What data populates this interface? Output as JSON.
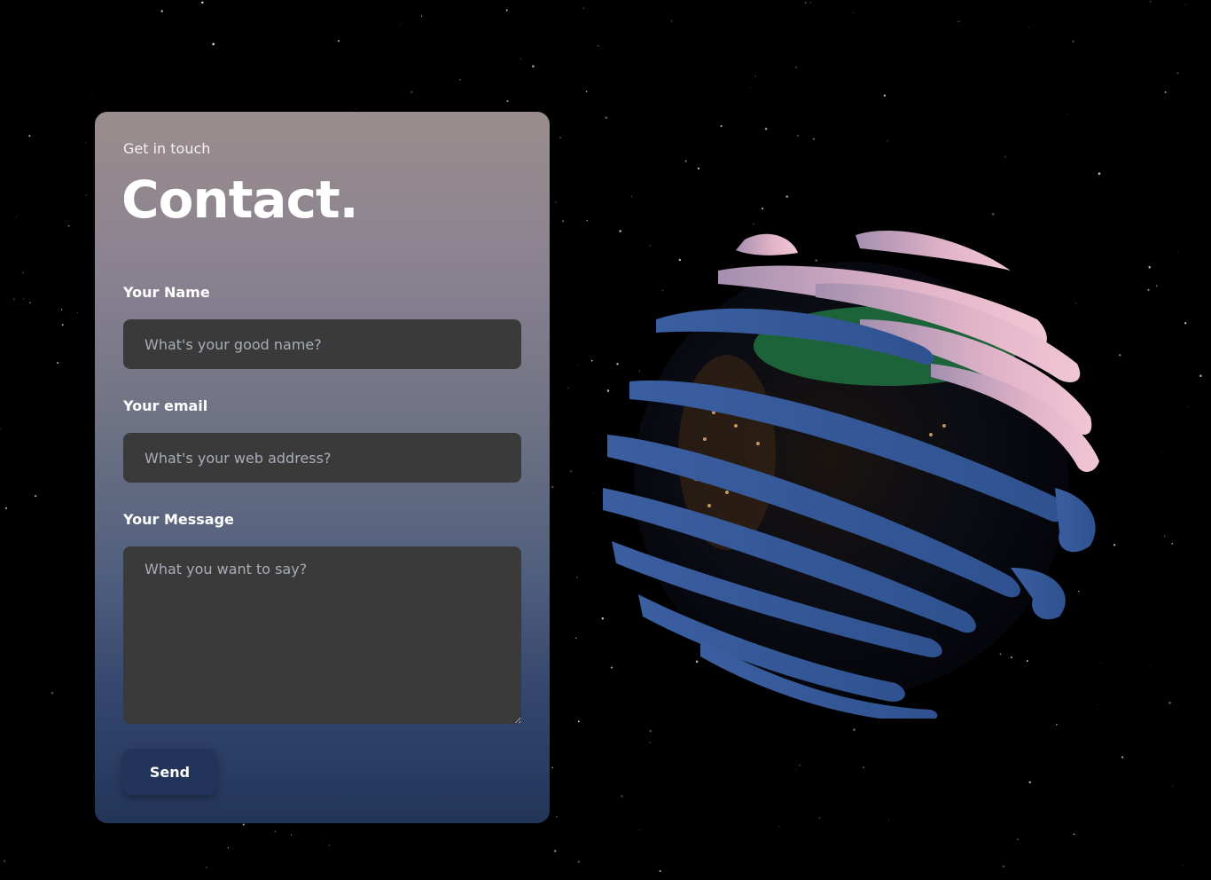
{
  "contact": {
    "subtitle": "Get in touch",
    "title": "Contact.",
    "fields": {
      "name": {
        "label": "Your Name",
        "placeholder": "What's your good name?"
      },
      "email": {
        "label": "Your email",
        "placeholder": "What's your web address?"
      },
      "message": {
        "label": "Your Message",
        "placeholder": "What you want to say?"
      }
    },
    "send_label": "Send"
  },
  "scene": {
    "background_color": "#000000",
    "card_gradient_top": "#9a8d8d",
    "card_gradient_bottom": "#223559",
    "input_background": "#3a3a3a",
    "button_background": "#23345a",
    "globe_icon": "earth-globe-3d-icon"
  }
}
